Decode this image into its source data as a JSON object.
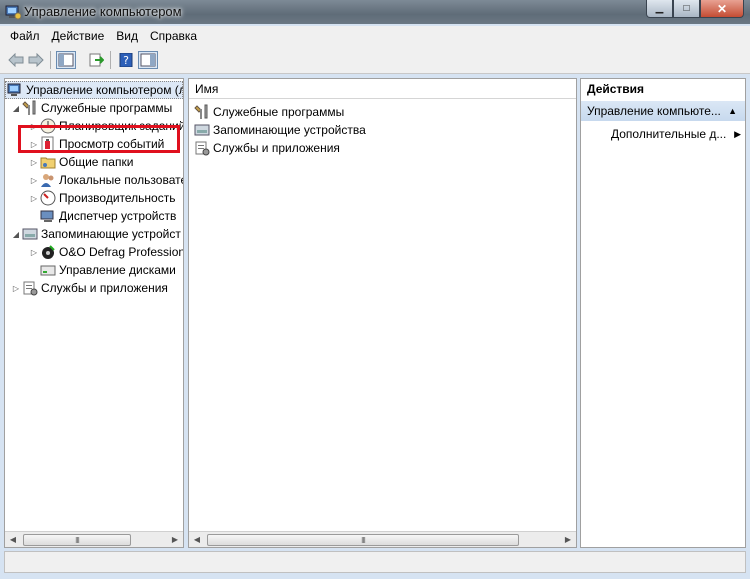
{
  "window": {
    "title": "Управление компьютером"
  },
  "menu": [
    "Файл",
    "Действие",
    "Вид",
    "Справка"
  ],
  "toolbar": {
    "back_icon": "back-arrow-icon",
    "forward_icon": "forward-arrow-icon",
    "show_hide_tree_icon": "console-tree-icon",
    "export_icon": "export-list-icon",
    "help_icon": "help-icon",
    "show_hide_action_icon": "action-pane-icon"
  },
  "tree": {
    "root": "Управление компьютером (л",
    "items": [
      {
        "label": "Служебные программы",
        "level": 1,
        "arrow": "◢",
        "icon": "tools-icon"
      },
      {
        "label": "Планировщик заданий",
        "level": 2,
        "arrow": "▷",
        "icon": "clock-icon"
      },
      {
        "label": "Просмотр событий",
        "level": 2,
        "arrow": "▷",
        "icon": "event-viewer-icon"
      },
      {
        "label": "Общие папки",
        "level": 2,
        "arrow": "▷",
        "icon": "shared-folder-icon"
      },
      {
        "label": "Локальные пользовате",
        "level": 2,
        "arrow": "▷",
        "icon": "users-icon"
      },
      {
        "label": "Производительность",
        "level": 2,
        "arrow": "▷",
        "icon": "performance-icon"
      },
      {
        "label": "Диспетчер устройств",
        "level": 2,
        "arrow": "",
        "icon": "device-manager-icon"
      },
      {
        "label": "Запоминающие устройст",
        "level": 1,
        "arrow": "◢",
        "icon": "storage-icon"
      },
      {
        "label": "O&O Defrag Profession",
        "level": 2,
        "arrow": "▷",
        "icon": "defrag-icon"
      },
      {
        "label": "Управление дисками",
        "level": 2,
        "arrow": "",
        "icon": "disk-management-icon"
      },
      {
        "label": "Службы и приложения",
        "level": 1,
        "arrow": "▷",
        "icon": "services-icon"
      }
    ]
  },
  "list": {
    "column_name": "Имя",
    "rows": [
      {
        "label": "Служебные программы",
        "icon": "tools-icon"
      },
      {
        "label": "Запоминающие устройства",
        "icon": "storage-icon"
      },
      {
        "label": "Службы и приложения",
        "icon": "services-icon"
      }
    ]
  },
  "actions": {
    "header": "Действия",
    "section": "Управление компьюте...",
    "more": "Дополнительные д..."
  },
  "scroll_grip": "III",
  "colors": {
    "highlight": "#e0101e",
    "selection": "#dde8f6"
  }
}
